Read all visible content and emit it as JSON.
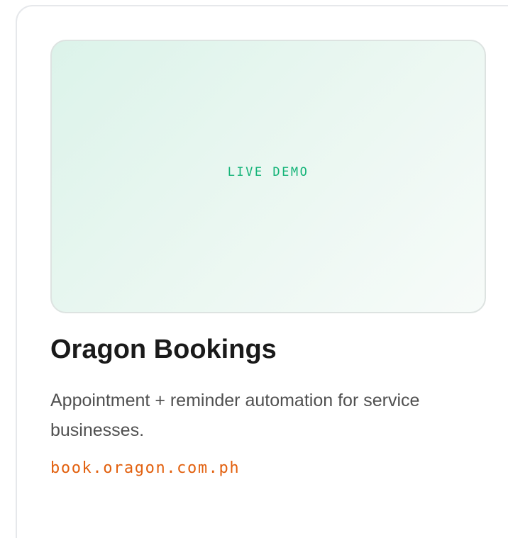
{
  "project_card": {
    "preview_label": "LIVE DEMO",
    "title": "Oragon Bookings",
    "description": "Appointment + reminder automation for service businesses.",
    "link_text": "book.oragon.com.ph"
  },
  "colors": {
    "accent_green": "#12b377",
    "link_orange": "#e2600e",
    "title_text": "#1a1a1a",
    "body_text": "#505050",
    "card_border": "#e6e8eb",
    "preview_bg": "#dcf3ea"
  }
}
